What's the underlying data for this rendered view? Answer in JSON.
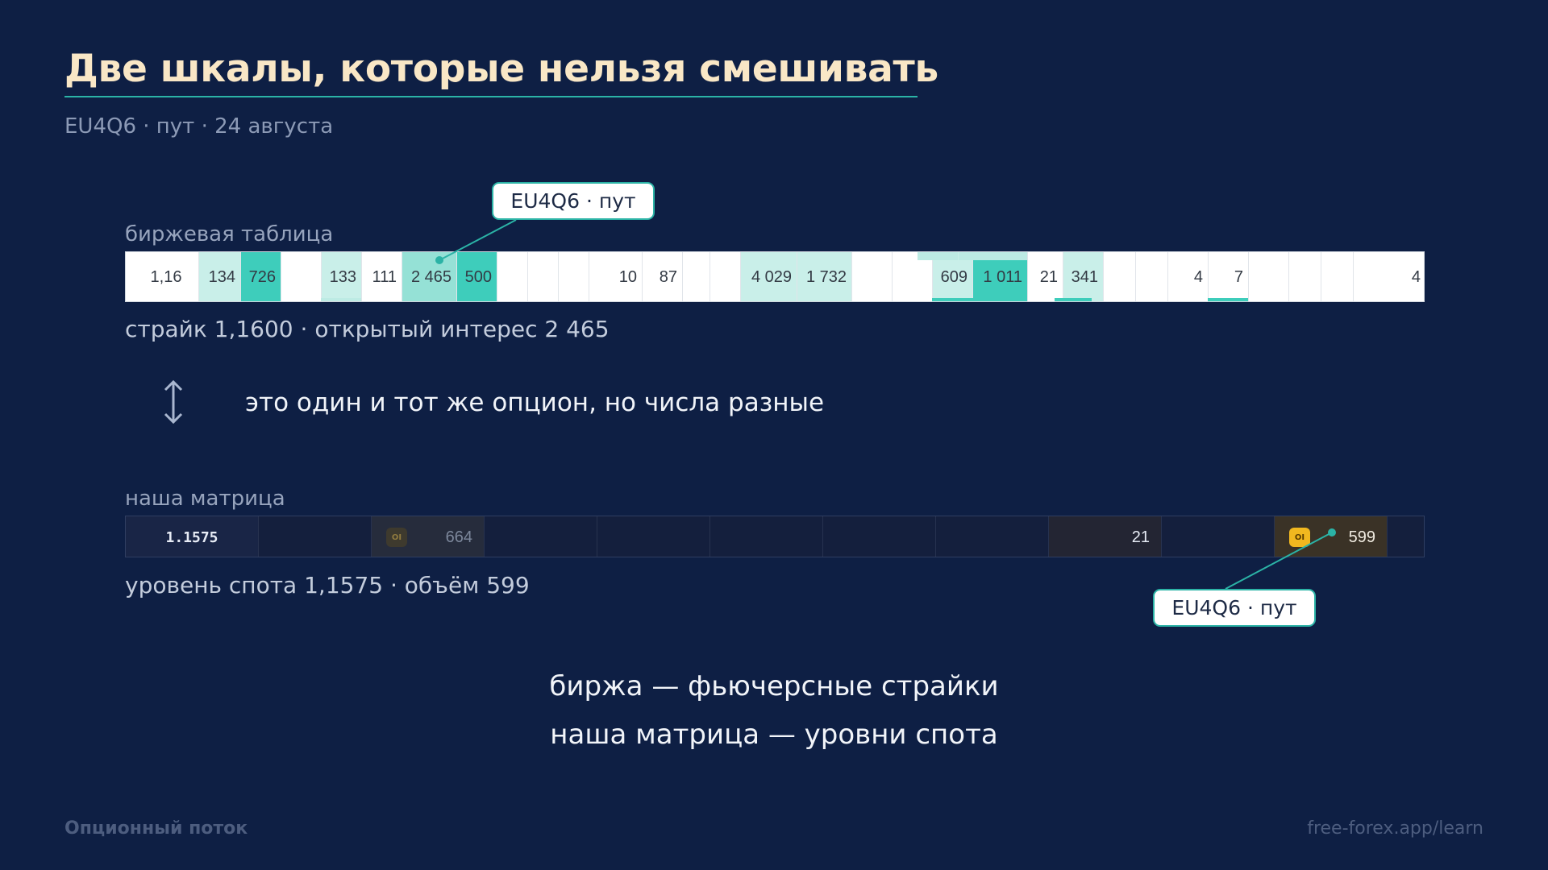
{
  "header": {
    "title": "Две шкалы, которые нельзя смешивать",
    "subtitle": "EU4Q6 · пут · 24 августа"
  },
  "exchange": {
    "label": "биржевая таблица",
    "callout": "EU4Q6 · пут",
    "caption": "страйк 1,1600 · открытый интерес 2 465",
    "cells": [
      "1,16",
      "134",
      "726",
      "133",
      "111",
      "2 465",
      "500",
      "10",
      "87",
      "4 029",
      "1 732",
      "609",
      "1 011",
      "21",
      "341",
      "4",
      "7",
      "4"
    ]
  },
  "comparison": {
    "note": "это один и тот же опцион, но числа разные",
    "arrow_icon": "up-down-arrow-icon"
  },
  "matrix": {
    "label": "наша матрица",
    "row_label": "1.1575",
    "oi_badge_text": "OI",
    "cells": [
      "664",
      "21",
      "599"
    ],
    "callout": "EU4Q6 · пут",
    "caption": "уровень спота 1,1575 · объём 599"
  },
  "summary": {
    "line1": "биржа — фьючерсные страйки",
    "line2": "наша матрица — уровни спота"
  },
  "footer": {
    "brand": "Опционный поток",
    "url": "free-forex.app/learn"
  },
  "colors": {
    "background": "#0e1f44",
    "title": "#f9e7c6",
    "accent_teal": "#2bb3a6",
    "oi_badge": "#f1b81f"
  }
}
